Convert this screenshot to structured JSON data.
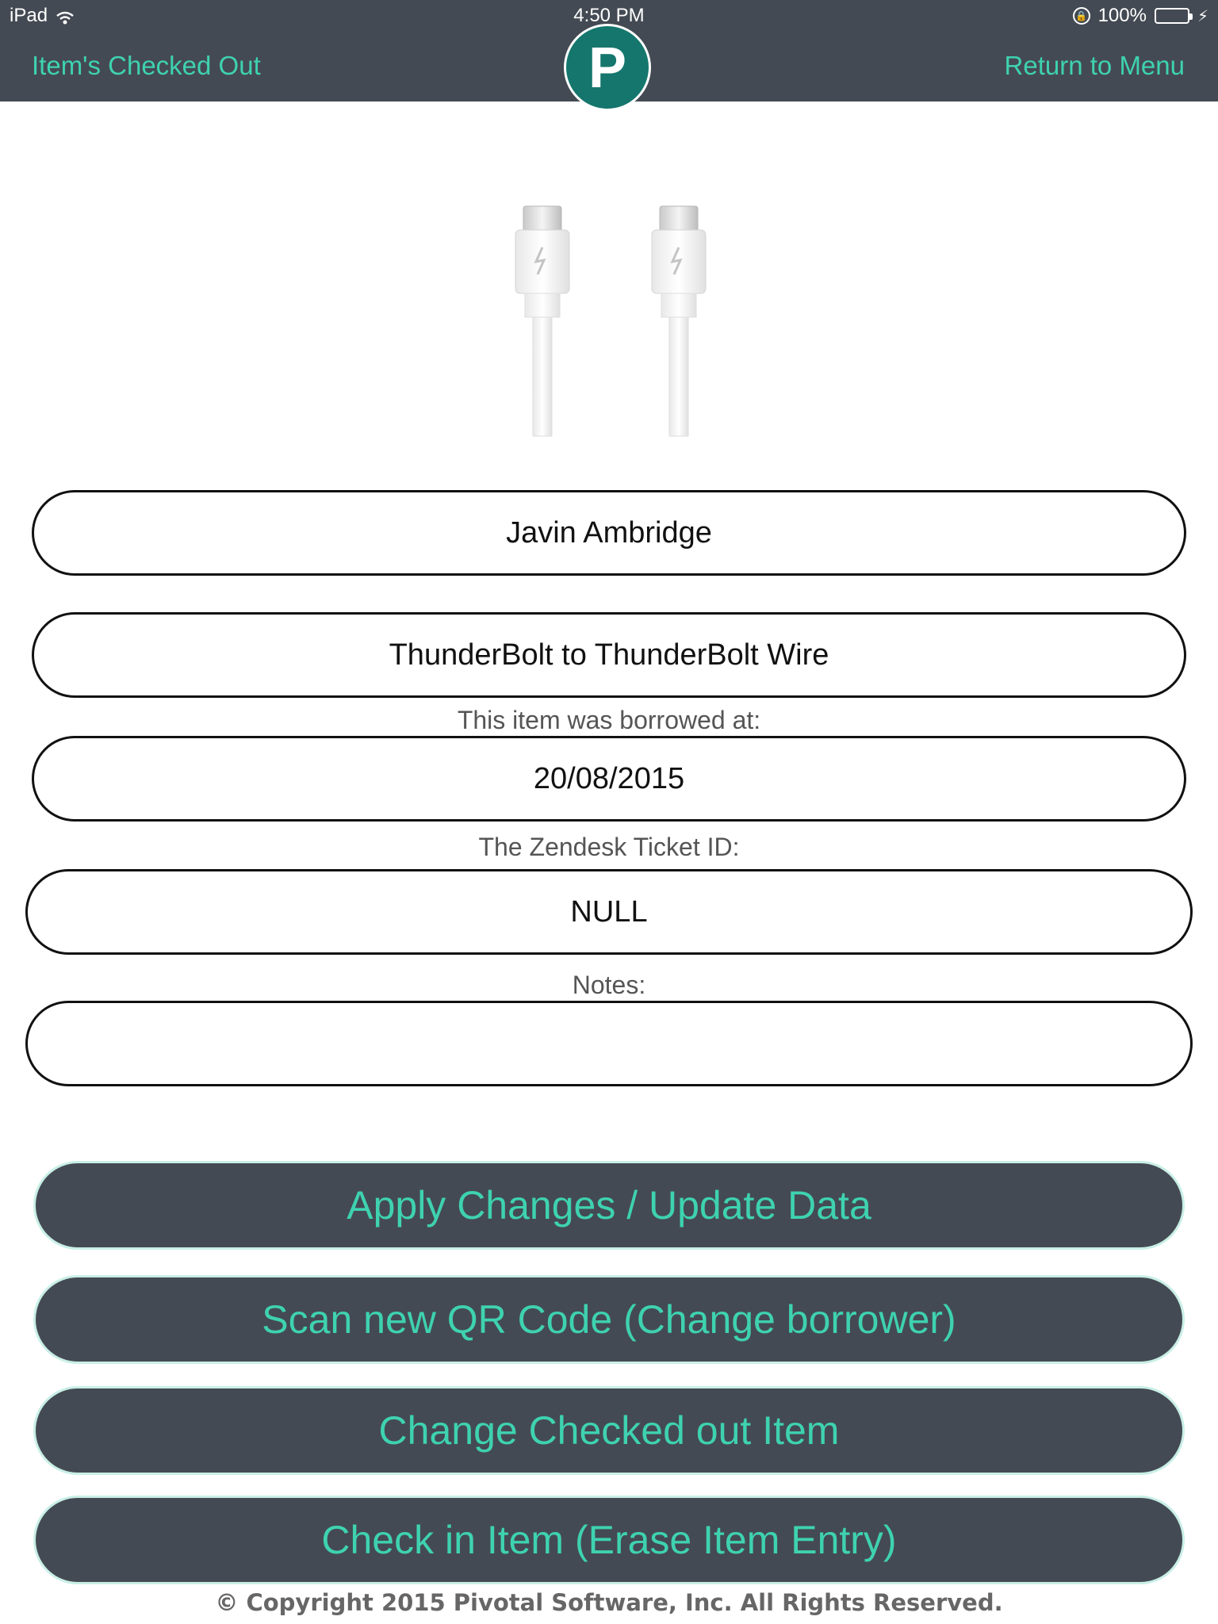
{
  "status_bar": {
    "device": "iPad",
    "time": "4:50 PM",
    "battery": "100%",
    "battery_level": 1.0
  },
  "nav": {
    "left_label": "Item's Checked Out",
    "right_label": "Return to Menu",
    "logo_letter": "P"
  },
  "fields": {
    "borrower_name": "Javin Ambridge",
    "item_name": "ThunderBolt to ThunderBolt Wire",
    "borrowed_caption": "This item was borrowed at:",
    "borrowed_date": "20/08/2015",
    "ticket_caption": "The Zendesk Ticket ID:",
    "ticket_id": "NULL",
    "notes_caption": "Notes:",
    "notes": ""
  },
  "actions": {
    "apply": "Apply Changes / Update Data",
    "scan": "Scan new QR Code (Change borrower)",
    "change_item": "Change Checked out Item",
    "check_in": "Check in Item (Erase Item Entry)"
  },
  "footer": {
    "copyright": "© Copyright 2015 Pivotal Software, Inc. All Rights Reserved."
  },
  "colors": {
    "bar": "#444a53",
    "accent": "#3ed2b0",
    "logo": "#15766d"
  },
  "icons": [
    "wifi-icon",
    "screen-lock-icon",
    "battery-icon",
    "charging-bolt-icon",
    "thunderbolt-cable-image"
  ]
}
